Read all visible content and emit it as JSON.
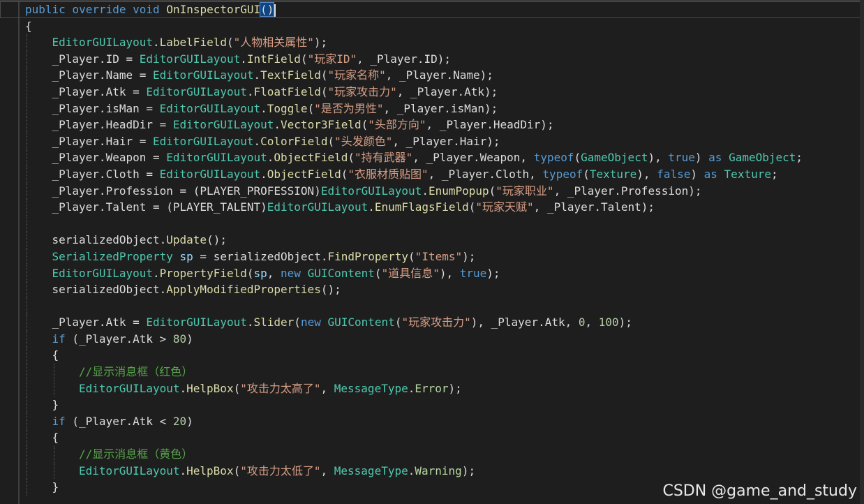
{
  "code": {
    "lines": [
      {
        "indent": 0,
        "tokens": [
          [
            "kw",
            "public"
          ],
          [
            "pl",
            " "
          ],
          [
            "kw",
            "override"
          ],
          [
            "pl",
            " "
          ],
          [
            "kw",
            "void"
          ],
          [
            "pl",
            " "
          ],
          [
            "fn",
            "OnInspectorGUI"
          ],
          [
            "hl",
            "()"
          ]
        ],
        "current": true
      },
      {
        "indent": 0,
        "tokens": [
          [
            "pl",
            "{"
          ]
        ]
      },
      {
        "indent": 1,
        "tokens": [
          [
            "ty",
            "EditorGUILayout"
          ],
          [
            "pl",
            "."
          ],
          [
            "fn",
            "LabelField"
          ],
          [
            "pl",
            "("
          ],
          [
            "str",
            "\"人物相关属性\""
          ],
          [
            "pl",
            ");"
          ]
        ]
      },
      {
        "indent": 1,
        "tokens": [
          [
            "pl",
            "_Player.ID = "
          ],
          [
            "ty",
            "EditorGUILayout"
          ],
          [
            "pl",
            "."
          ],
          [
            "fn",
            "IntField"
          ],
          [
            "pl",
            "("
          ],
          [
            "str",
            "\"玩家ID\""
          ],
          [
            "pl",
            ", _Player.ID);"
          ]
        ]
      },
      {
        "indent": 1,
        "tokens": [
          [
            "pl",
            "_Player.Name = "
          ],
          [
            "ty",
            "EditorGUILayout"
          ],
          [
            "pl",
            "."
          ],
          [
            "fn",
            "TextField"
          ],
          [
            "pl",
            "("
          ],
          [
            "str",
            "\"玩家名称\""
          ],
          [
            "pl",
            ", _Player.Name);"
          ]
        ]
      },
      {
        "indent": 1,
        "tokens": [
          [
            "pl",
            "_Player.Atk = "
          ],
          [
            "ty",
            "EditorGUILayout"
          ],
          [
            "pl",
            "."
          ],
          [
            "fn",
            "FloatField"
          ],
          [
            "pl",
            "("
          ],
          [
            "str",
            "\"玩家攻击力\""
          ],
          [
            "pl",
            ", _Player.Atk);"
          ]
        ]
      },
      {
        "indent": 1,
        "tokens": [
          [
            "pl",
            "_Player.isMan = "
          ],
          [
            "ty",
            "EditorGUILayout"
          ],
          [
            "pl",
            "."
          ],
          [
            "fn",
            "Toggle"
          ],
          [
            "pl",
            "("
          ],
          [
            "str",
            "\"是否为男性\""
          ],
          [
            "pl",
            ", _Player.isMan);"
          ]
        ]
      },
      {
        "indent": 1,
        "tokens": [
          [
            "pl",
            "_Player.HeadDir = "
          ],
          [
            "ty",
            "EditorGUILayout"
          ],
          [
            "pl",
            "."
          ],
          [
            "fn",
            "Vector3Field"
          ],
          [
            "pl",
            "("
          ],
          [
            "str",
            "\"头部方向\""
          ],
          [
            "pl",
            ", _Player.HeadDir);"
          ]
        ]
      },
      {
        "indent": 1,
        "tokens": [
          [
            "pl",
            "_Player.Hair = "
          ],
          [
            "ty",
            "EditorGUILayout"
          ],
          [
            "pl",
            "."
          ],
          [
            "fn",
            "ColorField"
          ],
          [
            "pl",
            "("
          ],
          [
            "str",
            "\"头发颜色\""
          ],
          [
            "pl",
            ", _Player.Hair);"
          ]
        ]
      },
      {
        "indent": 1,
        "tokens": [
          [
            "pl",
            "_Player.Weapon = "
          ],
          [
            "ty",
            "EditorGUILayout"
          ],
          [
            "pl",
            "."
          ],
          [
            "fn",
            "ObjectField"
          ],
          [
            "pl",
            "("
          ],
          [
            "str",
            "\"持有武器\""
          ],
          [
            "pl",
            ", _Player.Weapon, "
          ],
          [
            "kw",
            "typeof"
          ],
          [
            "pl",
            "("
          ],
          [
            "ty",
            "GameObject"
          ],
          [
            "pl",
            "), "
          ],
          [
            "kw",
            "true"
          ],
          [
            "pl",
            ") "
          ],
          [
            "kw",
            "as"
          ],
          [
            "pl",
            " "
          ],
          [
            "ty",
            "GameObject"
          ],
          [
            "pl",
            ";"
          ]
        ]
      },
      {
        "indent": 1,
        "tokens": [
          [
            "pl",
            "_Player.Cloth = "
          ],
          [
            "ty",
            "EditorGUILayout"
          ],
          [
            "pl",
            "."
          ],
          [
            "fn",
            "ObjectField"
          ],
          [
            "pl",
            "("
          ],
          [
            "str",
            "\"衣服材质贴图\""
          ],
          [
            "pl",
            ", _Player.Cloth, "
          ],
          [
            "kw",
            "typeof"
          ],
          [
            "pl",
            "("
          ],
          [
            "ty",
            "Texture"
          ],
          [
            "pl",
            "), "
          ],
          [
            "kw",
            "false"
          ],
          [
            "pl",
            ") "
          ],
          [
            "kw",
            "as"
          ],
          [
            "pl",
            " "
          ],
          [
            "ty",
            "Texture"
          ],
          [
            "pl",
            ";"
          ]
        ]
      },
      {
        "indent": 1,
        "tokens": [
          [
            "pl",
            "_Player.Profession = (PLAYER_PROFESSION)"
          ],
          [
            "ty",
            "EditorGUILayout"
          ],
          [
            "pl",
            "."
          ],
          [
            "fn",
            "EnumPopup"
          ],
          [
            "pl",
            "("
          ],
          [
            "str",
            "\"玩家职业\""
          ],
          [
            "pl",
            ", _Player.Profession);"
          ]
        ]
      },
      {
        "indent": 1,
        "tokens": [
          [
            "pl",
            "_Player.Talent = (PLAYER_TALENT)"
          ],
          [
            "ty",
            "EditorGUILayout"
          ],
          [
            "pl",
            "."
          ],
          [
            "fn",
            "EnumFlagsField"
          ],
          [
            "pl",
            "("
          ],
          [
            "str",
            "\"玩家天赋\""
          ],
          [
            "pl",
            ", _Player.Talent);"
          ]
        ]
      },
      {
        "indent": 1,
        "tokens": []
      },
      {
        "indent": 1,
        "tokens": [
          [
            "pl",
            "serializedObject."
          ],
          [
            "fn",
            "Update"
          ],
          [
            "pl",
            "();"
          ]
        ]
      },
      {
        "indent": 1,
        "tokens": [
          [
            "ty",
            "SerializedProperty"
          ],
          [
            "pl",
            " "
          ],
          [
            "var",
            "sp"
          ],
          [
            "pl",
            " = serializedObject."
          ],
          [
            "fn",
            "FindProperty"
          ],
          [
            "pl",
            "("
          ],
          [
            "str",
            "\"Items\""
          ],
          [
            "pl",
            ");"
          ]
        ]
      },
      {
        "indent": 1,
        "tokens": [
          [
            "ty",
            "EditorGUILayout"
          ],
          [
            "pl",
            "."
          ],
          [
            "fn",
            "PropertyField"
          ],
          [
            "pl",
            "("
          ],
          [
            "var",
            "sp"
          ],
          [
            "pl",
            ", "
          ],
          [
            "kw",
            "new"
          ],
          [
            "pl",
            " "
          ],
          [
            "ty",
            "GUIContent"
          ],
          [
            "pl",
            "("
          ],
          [
            "str",
            "\"道具信息\""
          ],
          [
            "pl",
            "), "
          ],
          [
            "kw",
            "true"
          ],
          [
            "pl",
            ");"
          ]
        ]
      },
      {
        "indent": 1,
        "tokens": [
          [
            "pl",
            "serializedObject."
          ],
          [
            "fn",
            "ApplyModifiedProperties"
          ],
          [
            "pl",
            "();"
          ]
        ]
      },
      {
        "indent": 1,
        "tokens": []
      },
      {
        "indent": 1,
        "tokens": [
          [
            "pl",
            "_Player.Atk = "
          ],
          [
            "ty",
            "EditorGUILayout"
          ],
          [
            "pl",
            "."
          ],
          [
            "fn",
            "Slider"
          ],
          [
            "pl",
            "("
          ],
          [
            "kw",
            "new"
          ],
          [
            "pl",
            " "
          ],
          [
            "ty",
            "GUIContent"
          ],
          [
            "pl",
            "("
          ],
          [
            "str",
            "\"玩家攻击力\""
          ],
          [
            "pl",
            "), _Player.Atk, "
          ],
          [
            "num",
            "0"
          ],
          [
            "pl",
            ", "
          ],
          [
            "num",
            "100"
          ],
          [
            "pl",
            ");"
          ]
        ]
      },
      {
        "indent": 1,
        "tokens": [
          [
            "kw",
            "if"
          ],
          [
            "pl",
            " (_Player.Atk > "
          ],
          [
            "num",
            "80"
          ],
          [
            "pl",
            ")"
          ]
        ]
      },
      {
        "indent": 1,
        "tokens": [
          [
            "pl",
            "{"
          ]
        ]
      },
      {
        "indent": 2,
        "tokens": [
          [
            "cm",
            "//显示消息框（红色）"
          ]
        ]
      },
      {
        "indent": 2,
        "tokens": [
          [
            "ty",
            "EditorGUILayout"
          ],
          [
            "pl",
            "."
          ],
          [
            "fn",
            "HelpBox"
          ],
          [
            "pl",
            "("
          ],
          [
            "str",
            "\"攻击力太高了\""
          ],
          [
            "pl",
            ", "
          ],
          [
            "ty",
            "MessageType"
          ],
          [
            "pl",
            "."
          ],
          [
            "enum",
            "Error"
          ],
          [
            "pl",
            ");"
          ]
        ]
      },
      {
        "indent": 1,
        "tokens": [
          [
            "pl",
            "}"
          ]
        ]
      },
      {
        "indent": 1,
        "tokens": [
          [
            "kw",
            "if"
          ],
          [
            "pl",
            " (_Player.Atk < "
          ],
          [
            "num",
            "20"
          ],
          [
            "pl",
            ")"
          ]
        ]
      },
      {
        "indent": 1,
        "tokens": [
          [
            "pl",
            "{"
          ]
        ]
      },
      {
        "indent": 2,
        "tokens": [
          [
            "cm",
            "//显示消息框（黄色）"
          ]
        ]
      },
      {
        "indent": 2,
        "tokens": [
          [
            "ty",
            "EditorGUILayout"
          ],
          [
            "pl",
            "."
          ],
          [
            "fn",
            "HelpBox"
          ],
          [
            "pl",
            "("
          ],
          [
            "str",
            "\"攻击力太低了\""
          ],
          [
            "pl",
            ", "
          ],
          [
            "ty",
            "MessageType"
          ],
          [
            "pl",
            "."
          ],
          [
            "enum",
            "Warning"
          ],
          [
            "pl",
            ");"
          ]
        ]
      },
      {
        "indent": 1,
        "tokens": [
          [
            "pl",
            "}"
          ]
        ]
      }
    ]
  },
  "watermark": "CSDN @game_and_study",
  "colors": {
    "background": "#1e1e1e",
    "keyword": "#569cd6",
    "type": "#4ec9b0",
    "method": "#dcdcaa",
    "string": "#d69d85",
    "number": "#b5cea8",
    "comment": "#57a64a"
  }
}
